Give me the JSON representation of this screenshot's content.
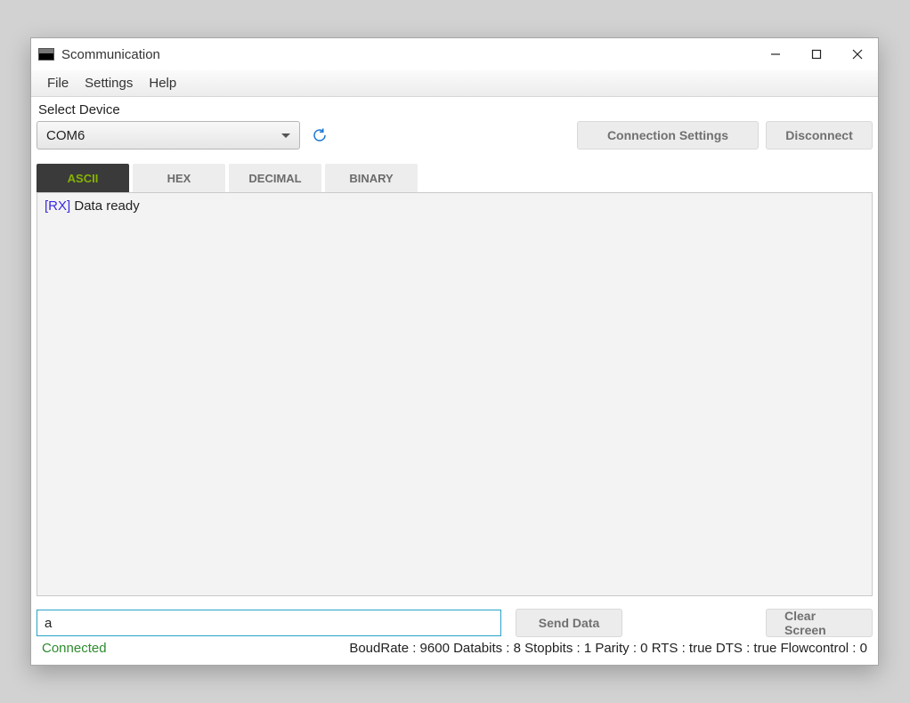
{
  "window": {
    "title": "Scommunication"
  },
  "menu": {
    "file": "File",
    "settings": "Settings",
    "help": "Help"
  },
  "device": {
    "label": "Select Device",
    "selected": "COM6"
  },
  "buttons": {
    "connection_settings": "Connection Settings",
    "disconnect": "Disconnect",
    "send_data": "Send Data",
    "clear_screen": "Clear Screen"
  },
  "tabs": {
    "ascii": "ASCII",
    "hex": "HEX",
    "decimal": "DECIMAL",
    "binary": "BINARY",
    "active": "ascii"
  },
  "terminal": {
    "rx_tag": "[RX]",
    "line0_text": " Data ready"
  },
  "input": {
    "value": "a"
  },
  "status": {
    "connection": "Connected",
    "params": "BoudRate : 9600 Databits : 8 Stopbits : 1 Parity : 0 RTS : true DTS : true Flowcontrol : 0"
  }
}
